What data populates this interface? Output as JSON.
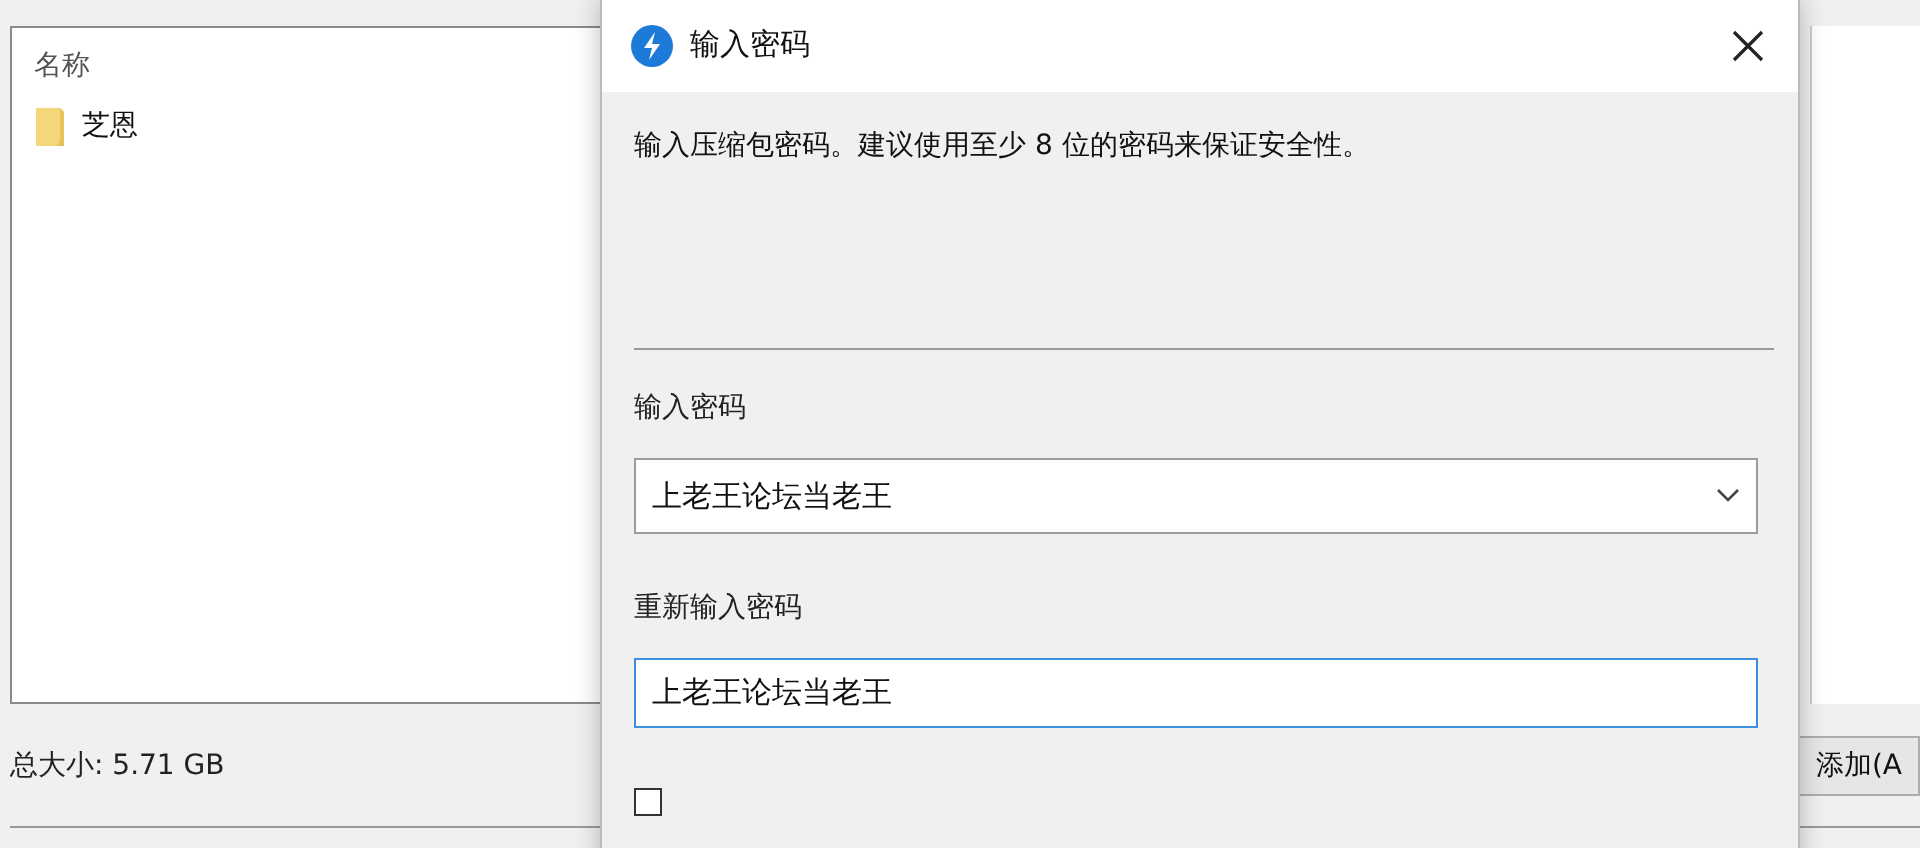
{
  "background_window": {
    "list": {
      "column_header": "名称",
      "items": [
        {
          "name": "芝恩",
          "kind": "folder"
        }
      ]
    },
    "total_size": "总大小: 5.71 GB",
    "add_button": "添加(A"
  },
  "dialog": {
    "title": "输入密码",
    "description": "输入压缩包密码。建议使用至少 8 位的密码来保证安全性。",
    "password_label": "输入密码",
    "password_value": "上老王论坛当老王",
    "confirm_label": "重新输入密码",
    "confirm_value": "上老王论坛当老王",
    "confirm_focused": true,
    "show_password": {
      "checked": false
    }
  }
}
